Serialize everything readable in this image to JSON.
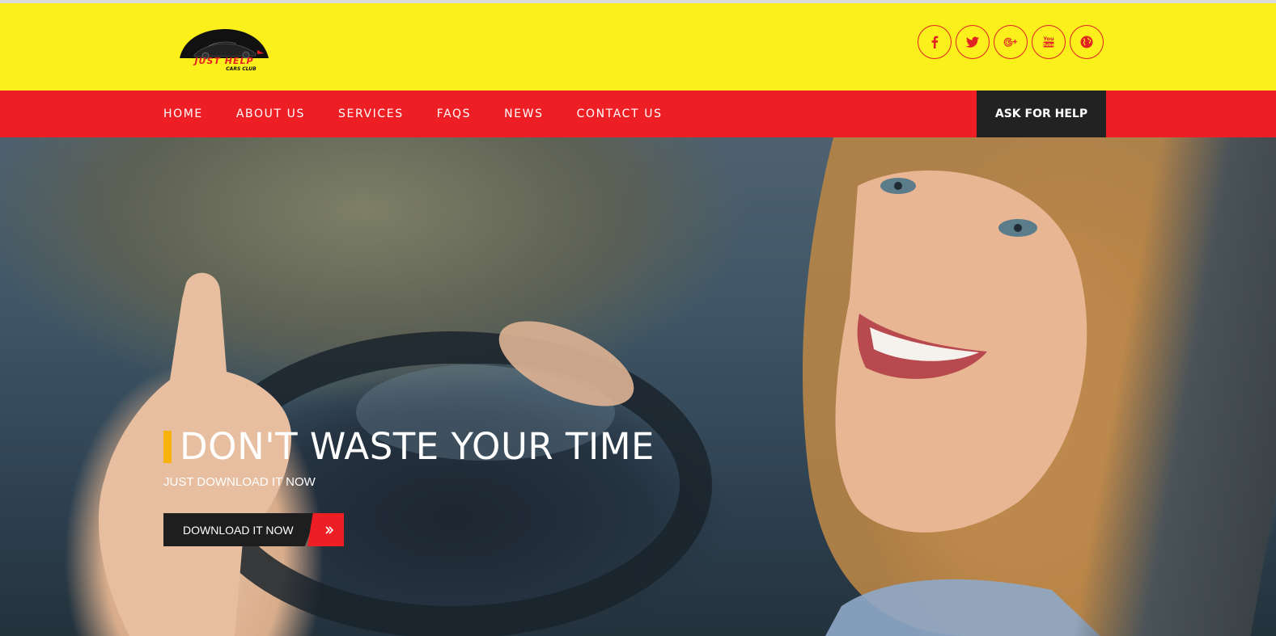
{
  "brand": {
    "logo_title": "JUST HELP",
    "logo_subtitle": "CARS CLUB"
  },
  "social": [
    {
      "icon": "facebook-icon"
    },
    {
      "icon": "twitter-icon"
    },
    {
      "icon": "google-plus-icon"
    },
    {
      "icon": "youtube-icon"
    },
    {
      "icon": "globe-icon"
    }
  ],
  "nav": {
    "items": [
      {
        "label": "HOME"
      },
      {
        "label": "ABOUT US"
      },
      {
        "label": "SERVICES"
      },
      {
        "label": "FAQS"
      },
      {
        "label": "NEWS"
      },
      {
        "label": "CONTACT US"
      }
    ],
    "cta_label": "ASK FOR HELP"
  },
  "hero": {
    "title": "DON'T WASTE YOUR TIME",
    "subtitle": "JUST DOWNLOAD IT NOW",
    "button_label": "DOWNLOAD IT NOW"
  },
  "colors": {
    "header_bg": "#fbef1c",
    "nav_bg": "#ed1f24",
    "accent": "#f7b20c",
    "dark": "#222222"
  }
}
